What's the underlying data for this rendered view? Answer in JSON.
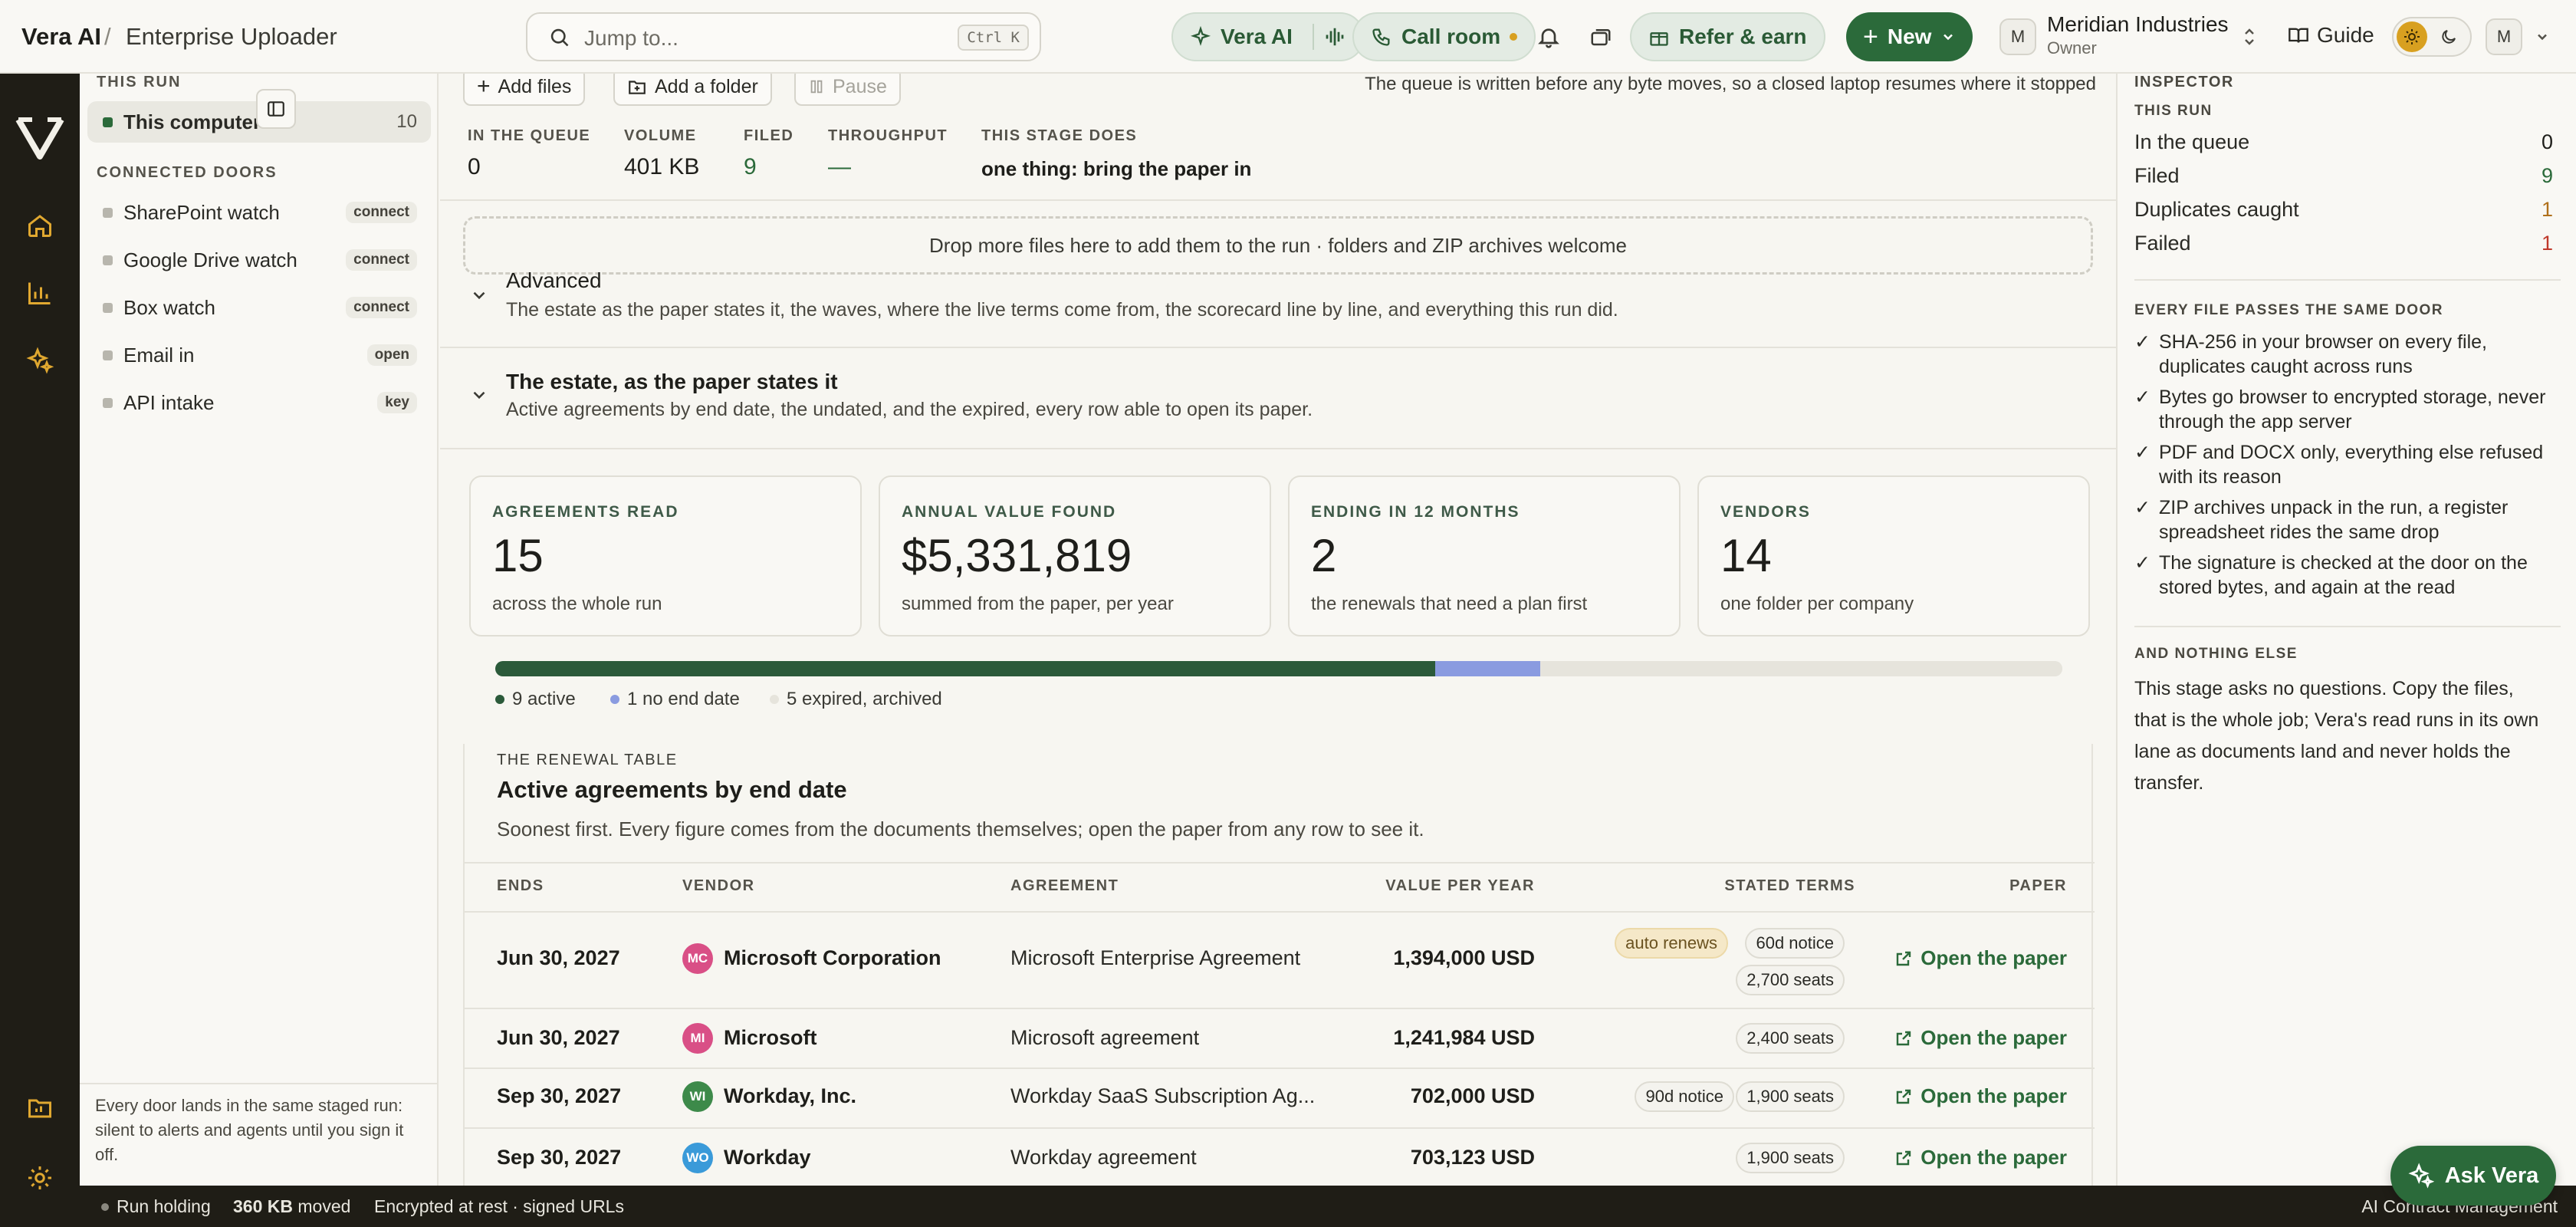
{
  "app": {
    "brand": "Vera AI",
    "crumb": "Enterprise Uploader"
  },
  "topbar": {
    "search_placeholder": "Jump to...",
    "search_shortcut": "Ctrl K",
    "vera_label": "Vera AI",
    "call_label": "Call room",
    "refer_label": "Refer & earn",
    "new_label": "New",
    "org_initial": "M",
    "org_name": "Meridian Industries",
    "org_role": "Owner",
    "guide_label": "Guide",
    "user_initial": "M"
  },
  "sidebar": {
    "this_run_heading": "THIS RUN",
    "active_item": {
      "label": "This computer",
      "count": "10"
    },
    "doors_heading": "CONNECTED DOORS",
    "doors": [
      {
        "label": "SharePoint watch",
        "badge": "connect"
      },
      {
        "label": "Google Drive watch",
        "badge": "connect"
      },
      {
        "label": "Box watch",
        "badge": "connect"
      },
      {
        "label": "Email in",
        "badge": "open"
      },
      {
        "label": "API intake",
        "badge": "key"
      }
    ],
    "footer": "Every door lands in the same staged run: silent to alerts and agents until you sign it off."
  },
  "toolbar": {
    "add_files": "Add files",
    "add_folder": "Add a folder",
    "pause": "Pause",
    "note": "The queue is written before any byte moves, so a closed laptop resumes where it stopped"
  },
  "stats": [
    {
      "key": "IN THE QUEUE",
      "value": "0"
    },
    {
      "key": "VOLUME",
      "value": "401 KB"
    },
    {
      "key": "FILED",
      "value": "9"
    },
    {
      "key": "THROUGHPUT",
      "value": "—"
    },
    {
      "key": "THIS STAGE DOES",
      "value": "one thing: bring the paper in"
    }
  ],
  "drop_zone": "Drop more files here to add them to the run · folders and ZIP archives welcome",
  "advanced": {
    "title": "Advanced",
    "subtitle": "The estate as the paper states it, the waves, where the live terms come from, the scorecard line by line, and everything this run did."
  },
  "estate": {
    "title": "The estate, as the paper states it",
    "subtitle": "Active agreements by end date, the undated, and the expired, every row able to open its paper."
  },
  "cards": [
    {
      "key": "AGREEMENTS READ",
      "value": "15",
      "sub": "across the whole run"
    },
    {
      "key": "ANNUAL VALUE FOUND",
      "value": "$5,331,819",
      "sub": "summed from the paper, per year"
    },
    {
      "key": "ENDING IN 12 MONTHS",
      "value": "2",
      "sub": "the renewals that need a plan first"
    },
    {
      "key": "VENDORS",
      "value": "14",
      "sub": "one folder per company"
    }
  ],
  "status_bar": {
    "segments": [
      {
        "label": "9 active",
        "count": 9,
        "color": "#2b5a3a"
      },
      {
        "label": "1 no end date",
        "count": 1,
        "color": "#8a9be0"
      },
      {
        "label": "5 expired, archived",
        "count": 5,
        "color": "#e6e4dc"
      }
    ]
  },
  "renewal": {
    "eyebrow": "THE RENEWAL TABLE",
    "title": "Active agreements by end date",
    "subtitle": "Soonest first. Every figure comes from the documents themselves; open the paper from any row to see it.",
    "headers": {
      "ends": "ENDS",
      "vendor": "VENDOR",
      "agreement": "AGREEMENT",
      "value": "VALUE PER YEAR",
      "terms": "STATED TERMS",
      "paper": "PAPER"
    },
    "open_label": "Open the paper",
    "rows": [
      {
        "ends": "Jun 30, 2027",
        "initials": "MC",
        "icon_color": "#d94f86",
        "vendor": "Microsoft Corporation",
        "agreement": "Microsoft Enterprise Agreement",
        "value": "1,394,000 USD",
        "tags": [
          "auto renews",
          "60d notice",
          "2,700 seats"
        ]
      },
      {
        "ends": "Jun 30, 2027",
        "initials": "MI",
        "icon_color": "#d94f86",
        "vendor": "Microsoft",
        "agreement": "Microsoft agreement",
        "value": "1,241,984 USD",
        "tags": [
          "2,400 seats"
        ]
      },
      {
        "ends": "Sep 30, 2027",
        "initials": "WI",
        "icon_color": "#3d8a4a",
        "vendor": "Workday, Inc.",
        "agreement": "Workday SaaS Subscription Ag...",
        "value": "702,000 USD",
        "tags": [
          "90d notice",
          "1,900 seats"
        ]
      },
      {
        "ends": "Sep 30, 2027",
        "initials": "WO",
        "icon_color": "#3a9ad9",
        "vendor": "Workday",
        "agreement": "Workday agreement",
        "value": "703,123 USD",
        "tags": [
          "1,900 seats"
        ]
      }
    ]
  },
  "inspector": {
    "heading": "INSPECTOR",
    "run_heading": "THIS RUN",
    "metrics": [
      {
        "label": "In the queue",
        "value": "0",
        "color": "#1e1e1a"
      },
      {
        "label": "Filed",
        "value": "9",
        "color": "#2b6a3a"
      },
      {
        "label": "Duplicates caught",
        "value": "1",
        "color": "#b0701a"
      },
      {
        "label": "Failed",
        "value": "1",
        "color": "#c0392b"
      }
    ],
    "door_heading": "EVERY FILE PASSES THE SAME DOOR",
    "checks": [
      "SHA-256 in your browser on every file, duplicates caught across runs",
      "Bytes go browser to encrypted storage, never through the app server",
      "PDF and DOCX only, everything else refused with its reason",
      "ZIP archives unpack in the run, a register spreadsheet rides the same drop",
      "The signature is checked at the door on the stored bytes, and again at the read"
    ],
    "nothing_heading": "AND NOTHING ELSE",
    "nothing_text": "This stage asks no questions. Copy the files, that is the whole job; Vera's read runs in its own lane as documents land and never holds the transfer."
  },
  "footer": {
    "run_status": "Run holding",
    "moved_value": "360 KB",
    "moved_label": "moved",
    "encryption": "Encrypted at rest · signed URLs",
    "product": "AI Contract Management"
  },
  "ask_vera": "Ask Vera"
}
